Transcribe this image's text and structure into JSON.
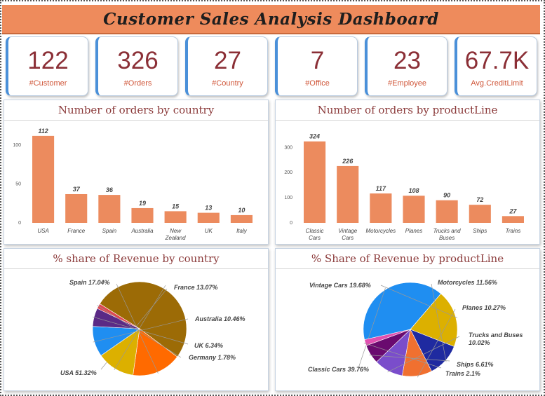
{
  "header": {
    "title": "Customer Sales Analysis Dashboard"
  },
  "kpis": [
    {
      "value": "122",
      "label": "#Customer"
    },
    {
      "value": "326",
      "label": "#Orders"
    },
    {
      "value": "27",
      "label": "#Country"
    },
    {
      "value": "7",
      "label": "#Office"
    },
    {
      "value": "23",
      "label": "#Employee"
    },
    {
      "value": "67.7K",
      "label": "Avg.CreditLimit"
    }
  ],
  "colors": {
    "bar": "#ec8b5e",
    "banner": "#ee8b5c",
    "kpi_value": "#8b2f36",
    "kpi_label": "#d0573a"
  },
  "chart_data": [
    {
      "type": "bar",
      "title": "Number of orders by country",
      "categories": [
        "USA",
        "France",
        "Spain",
        "Australia",
        "New Zealand",
        "UK",
        "Italy"
      ],
      "values": [
        112,
        37,
        36,
        19,
        15,
        13,
        10
      ],
      "yticks": [
        0,
        50,
        100
      ],
      "ylim": [
        0,
        120
      ],
      "grid": false
    },
    {
      "type": "bar",
      "title": "Number of orders by productLine",
      "categories": [
        "Classic Cars",
        "Vintage Cars",
        "Motorcycles",
        "Planes",
        "Trucks and Buses",
        "Ships",
        "Trains"
      ],
      "values": [
        324,
        226,
        117,
        108,
        90,
        72,
        27
      ],
      "yticks": [
        0,
        100,
        200,
        300
      ],
      "ylim": [
        0,
        340
      ],
      "grid": false
    },
    {
      "type": "pie",
      "title": "% share of Revenue by country",
      "slices": [
        {
          "label": "USA",
          "value": 51.32,
          "text": "USA 51.32%",
          "color": "#9c6b06"
        },
        {
          "label": "Spain",
          "value": 17.04,
          "text": "Spain 17.04%",
          "color": "#ff6a00"
        },
        {
          "label": "France",
          "value": 13.07,
          "text": "France 13.07%",
          "color": "#dcb000"
        },
        {
          "label": "Australia",
          "value": 10.46,
          "text": "Australia 10.46%",
          "color": "#1f8ef1"
        },
        {
          "label": "UK",
          "value": 6.34,
          "text": "UK 6.34%",
          "color": "#5b2a86"
        },
        {
          "label": "Germany",
          "value": 1.78,
          "text": "Germany 1.78%",
          "color": "#e0464f"
        }
      ]
    },
    {
      "type": "pie",
      "title": "% Share of Revenue by productLine",
      "slices": [
        {
          "label": "Classic Cars",
          "value": 39.76,
          "text": "Classic Cars 39.76%",
          "color": "#1f8ef1"
        },
        {
          "label": "Vintage Cars",
          "value": 19.68,
          "text": "Vintage Cars 19.68%",
          "color": "#dcb000"
        },
        {
          "label": "Motorcycles",
          "value": 11.56,
          "text": "Motorcycles 11.56%",
          "color": "#1f2aa0"
        },
        {
          "label": "Planes",
          "value": 10.27,
          "text": "Planes 10.27%",
          "color": "#f07030"
        },
        {
          "label": "Trucks and Buses",
          "value": 10.02,
          "text": "Trucks and Buses 10.02%",
          "color": "#7a4dcb"
        },
        {
          "label": "Ships",
          "value": 6.61,
          "text": "Ships 6.61%",
          "color": "#6a0a6f"
        },
        {
          "label": "Trains",
          "value": 2.1,
          "text": "Trains 2.1%",
          "color": "#e04fb0"
        }
      ]
    }
  ]
}
